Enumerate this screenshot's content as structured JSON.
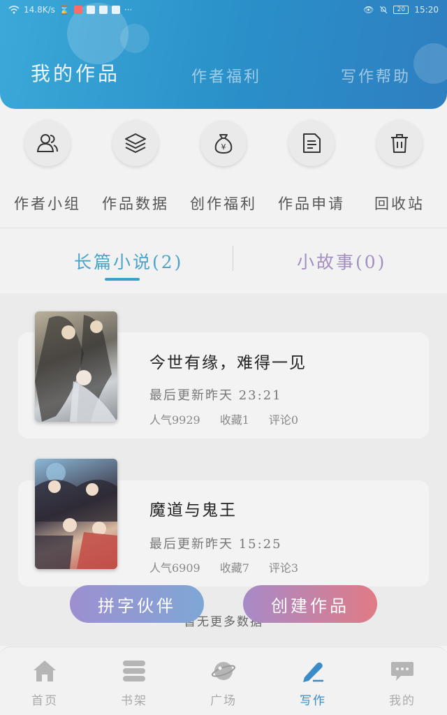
{
  "status_bar": {
    "net_speed": "14.8K/s",
    "time": "15:20",
    "battery": "20",
    "more": "···"
  },
  "header": {
    "tabs": [
      {
        "label": "我的作品",
        "active": true
      },
      {
        "label": "作者福利",
        "active": false
      },
      {
        "label": "写作帮助",
        "active": false
      }
    ]
  },
  "shortcuts": [
    {
      "label": "作者小组",
      "icon": "users-icon"
    },
    {
      "label": "作品数据",
      "icon": "layers-icon"
    },
    {
      "label": "创作福利",
      "icon": "money-bag-icon"
    },
    {
      "label": "作品申请",
      "icon": "document-icon"
    },
    {
      "label": "回收站",
      "icon": "trash-icon"
    }
  ],
  "category_tabs": [
    {
      "label": "长篇小说(2)",
      "active": true
    },
    {
      "label": "小故事(0)",
      "active": false
    }
  ],
  "works": [
    {
      "title": "今世有缘，难得一见",
      "updated": "最后更新昨天  23:21",
      "popularity": "人气9929",
      "favorites": "收藏1",
      "comments": "评论0"
    },
    {
      "title": "魔道与鬼王",
      "updated": "最后更新昨天  15:25",
      "popularity": "人气6909",
      "favorites": "收藏7",
      "comments": "评论3"
    }
  ],
  "no_more": "暂无更多数据",
  "buttons": {
    "partner": "拼字伙伴",
    "create": "创建作品"
  },
  "bottom_nav": [
    {
      "label": "首页",
      "icon": "home-icon",
      "active": false
    },
    {
      "label": "书架",
      "icon": "bookshelf-icon",
      "active": false
    },
    {
      "label": "广场",
      "icon": "planet-icon",
      "active": false
    },
    {
      "label": "写作",
      "icon": "pen-icon",
      "active": true
    },
    {
      "label": "我的",
      "icon": "chat-bubble-icon",
      "active": false
    }
  ],
  "colors": {
    "header_start": "#3aa9d8",
    "header_end": "#2f7fc0",
    "accent": "#3a8cc8",
    "fab_partner": "#9d8fd0",
    "fab_create": "#e07b86"
  }
}
